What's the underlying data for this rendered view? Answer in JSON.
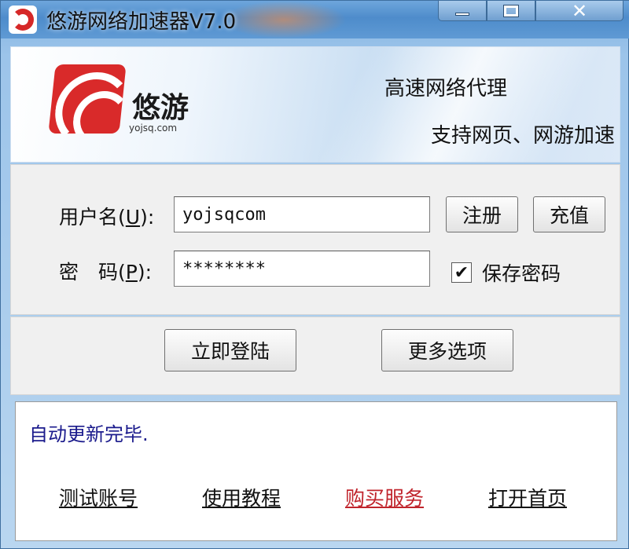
{
  "window": {
    "title": "悠游网络加速器V7.0",
    "controls": {
      "minimize_icon": "minimize-icon",
      "maximize_icon": "maximize-icon",
      "close_icon": "close-icon",
      "close_glyph": "✕"
    }
  },
  "banner": {
    "logo_name": "悠游",
    "logo_url": "yojsq.com",
    "slogan_line1": "高速网络代理",
    "slogan_line2": "支持网页、网游加速"
  },
  "login": {
    "username_label": "用户名",
    "username_key": "U",
    "username_value": "yojsqcom",
    "password_label": "密　码",
    "password_key": "P",
    "password_value": "********",
    "register_button": "注册",
    "recharge_button": "充值",
    "save_password_label": "保存密码",
    "save_password_checked": true
  },
  "actions": {
    "login_button": "立即登陆",
    "more_options_button": "更多选项"
  },
  "status": {
    "message": "自动更新完毕."
  },
  "links": [
    {
      "label": "测试账号",
      "color": "#111111"
    },
    {
      "label": "使用教程",
      "color": "#111111"
    },
    {
      "label": "购买服务",
      "color": "#c0242c"
    },
    {
      "label": "打开首页",
      "color": "#111111"
    }
  ],
  "colors": {
    "accent_red": "#d92a2a",
    "status_text": "#1a1a8c",
    "titlebar": "#4e8ccb"
  }
}
